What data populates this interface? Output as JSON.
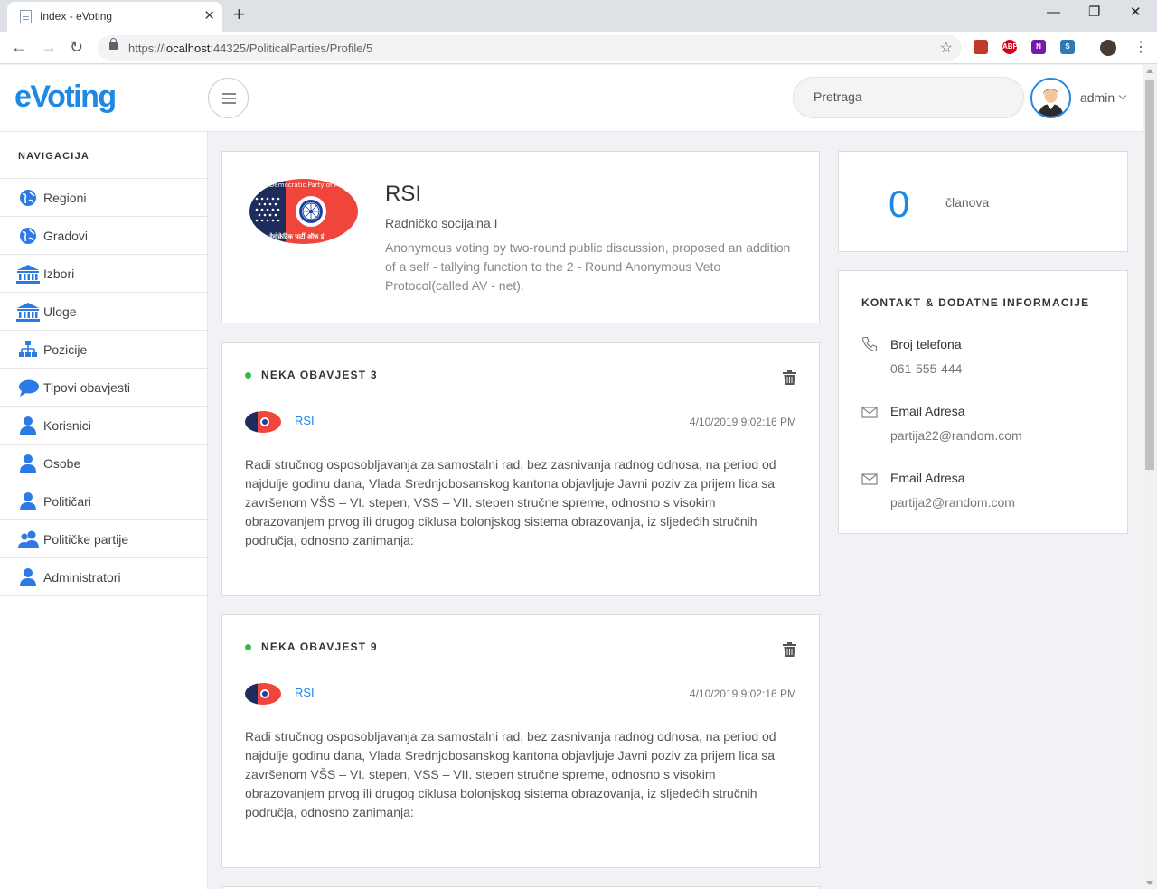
{
  "browser": {
    "tab_title": "Index - eVoting",
    "url_prefix": "https://",
    "url_host": "localhost",
    "url_rest": ":44325/PoliticalParties/Profile/5",
    "ext_abp": "ABP",
    "ext_onenote": "N",
    "ext_s": "S"
  },
  "header": {
    "brand": "eVoting",
    "search_placeholder": "Pretraga",
    "user_name": "admin"
  },
  "sidebar": {
    "heading": "NAVIGACIJA",
    "items": [
      {
        "label": "Regioni",
        "icon": "globe-icon"
      },
      {
        "label": "Gradovi",
        "icon": "globe-icon"
      },
      {
        "label": "Izbori",
        "icon": "institution-icon"
      },
      {
        "label": "Uloge",
        "icon": "institution-icon"
      },
      {
        "label": "Pozicije",
        "icon": "sitemap-icon"
      },
      {
        "label": "Tipovi obavjesti",
        "icon": "chat-bubble-icon"
      },
      {
        "label": "Korisnici",
        "icon": "user-icon"
      },
      {
        "label": "Osobe",
        "icon": "user-icon"
      },
      {
        "label": "Političari",
        "icon": "user-icon"
      },
      {
        "label": "Političke partije",
        "icon": "users-icon"
      },
      {
        "label": "Administratori",
        "icon": "user-icon"
      }
    ]
  },
  "party": {
    "name": "RSI",
    "subtitle": "Radničko socijalna I",
    "description": "Anonymous voting by two-round public discussion, proposed an addition of a self - tallying function to the 2 - Round Anonymous Veto Protocol(called AV - net).",
    "logo_top_text": "Democratic Party of I",
    "logo_bottom_text": "डेमोक्रेटिक पार्टी ऑफ़ इं"
  },
  "stats": {
    "count": "0",
    "label": "članova"
  },
  "posts": [
    {
      "title": "NEKA OBAVJEST 3",
      "author": "RSI",
      "date": "4/10/2019 9:02:16 PM",
      "body": "Radi stručnog osposobljavanja za samostalni rad, bez zasnivanja radnog odnosa, na period od najdulje godinu dana, Vlada Srednjobosanskog kantona objavljuje Javni poziv za prijem lica sa završenom VŠS – VI. stepen, VSS – VII. stepen stručne spreme, odnosno s visokim obrazovanjem prvog ili drugog ciklusa bolonjskog sistema obrazovanja, iz sljedećih stručnih područja, odnosno zanimanja:"
    },
    {
      "title": "NEKA OBAVJEST 9",
      "author": "RSI",
      "date": "4/10/2019 9:02:16 PM",
      "body": "Radi stručnog osposobljavanja za samostalni rad, bez zasnivanja radnog odnosa, na period od najdulje godinu dana, Vlada Srednjobosanskog kantona objavljuje Javni poziv za prijem lica sa završenom VŠS – VI. stepen, VSS – VII. stepen stručne spreme, odnosno s visokim obrazovanjem prvog ili drugog ciklusa bolonjskog sistema obrazovanja, iz sljedećih stručnih područja, odnosno zanimanja:"
    }
  ],
  "contact": {
    "title": "KONTAKT & DODATNE INFORMACIJE",
    "phone_label": "Broj telefona",
    "phone": "061-555-444",
    "email1_label": "Email Adresa",
    "email1": "partija22@random.com",
    "email2_label": "Email Adresa",
    "email2": "partija2@random.com"
  },
  "colors": {
    "accent": "#1e88e5",
    "status_dot": "#2fbc48"
  }
}
